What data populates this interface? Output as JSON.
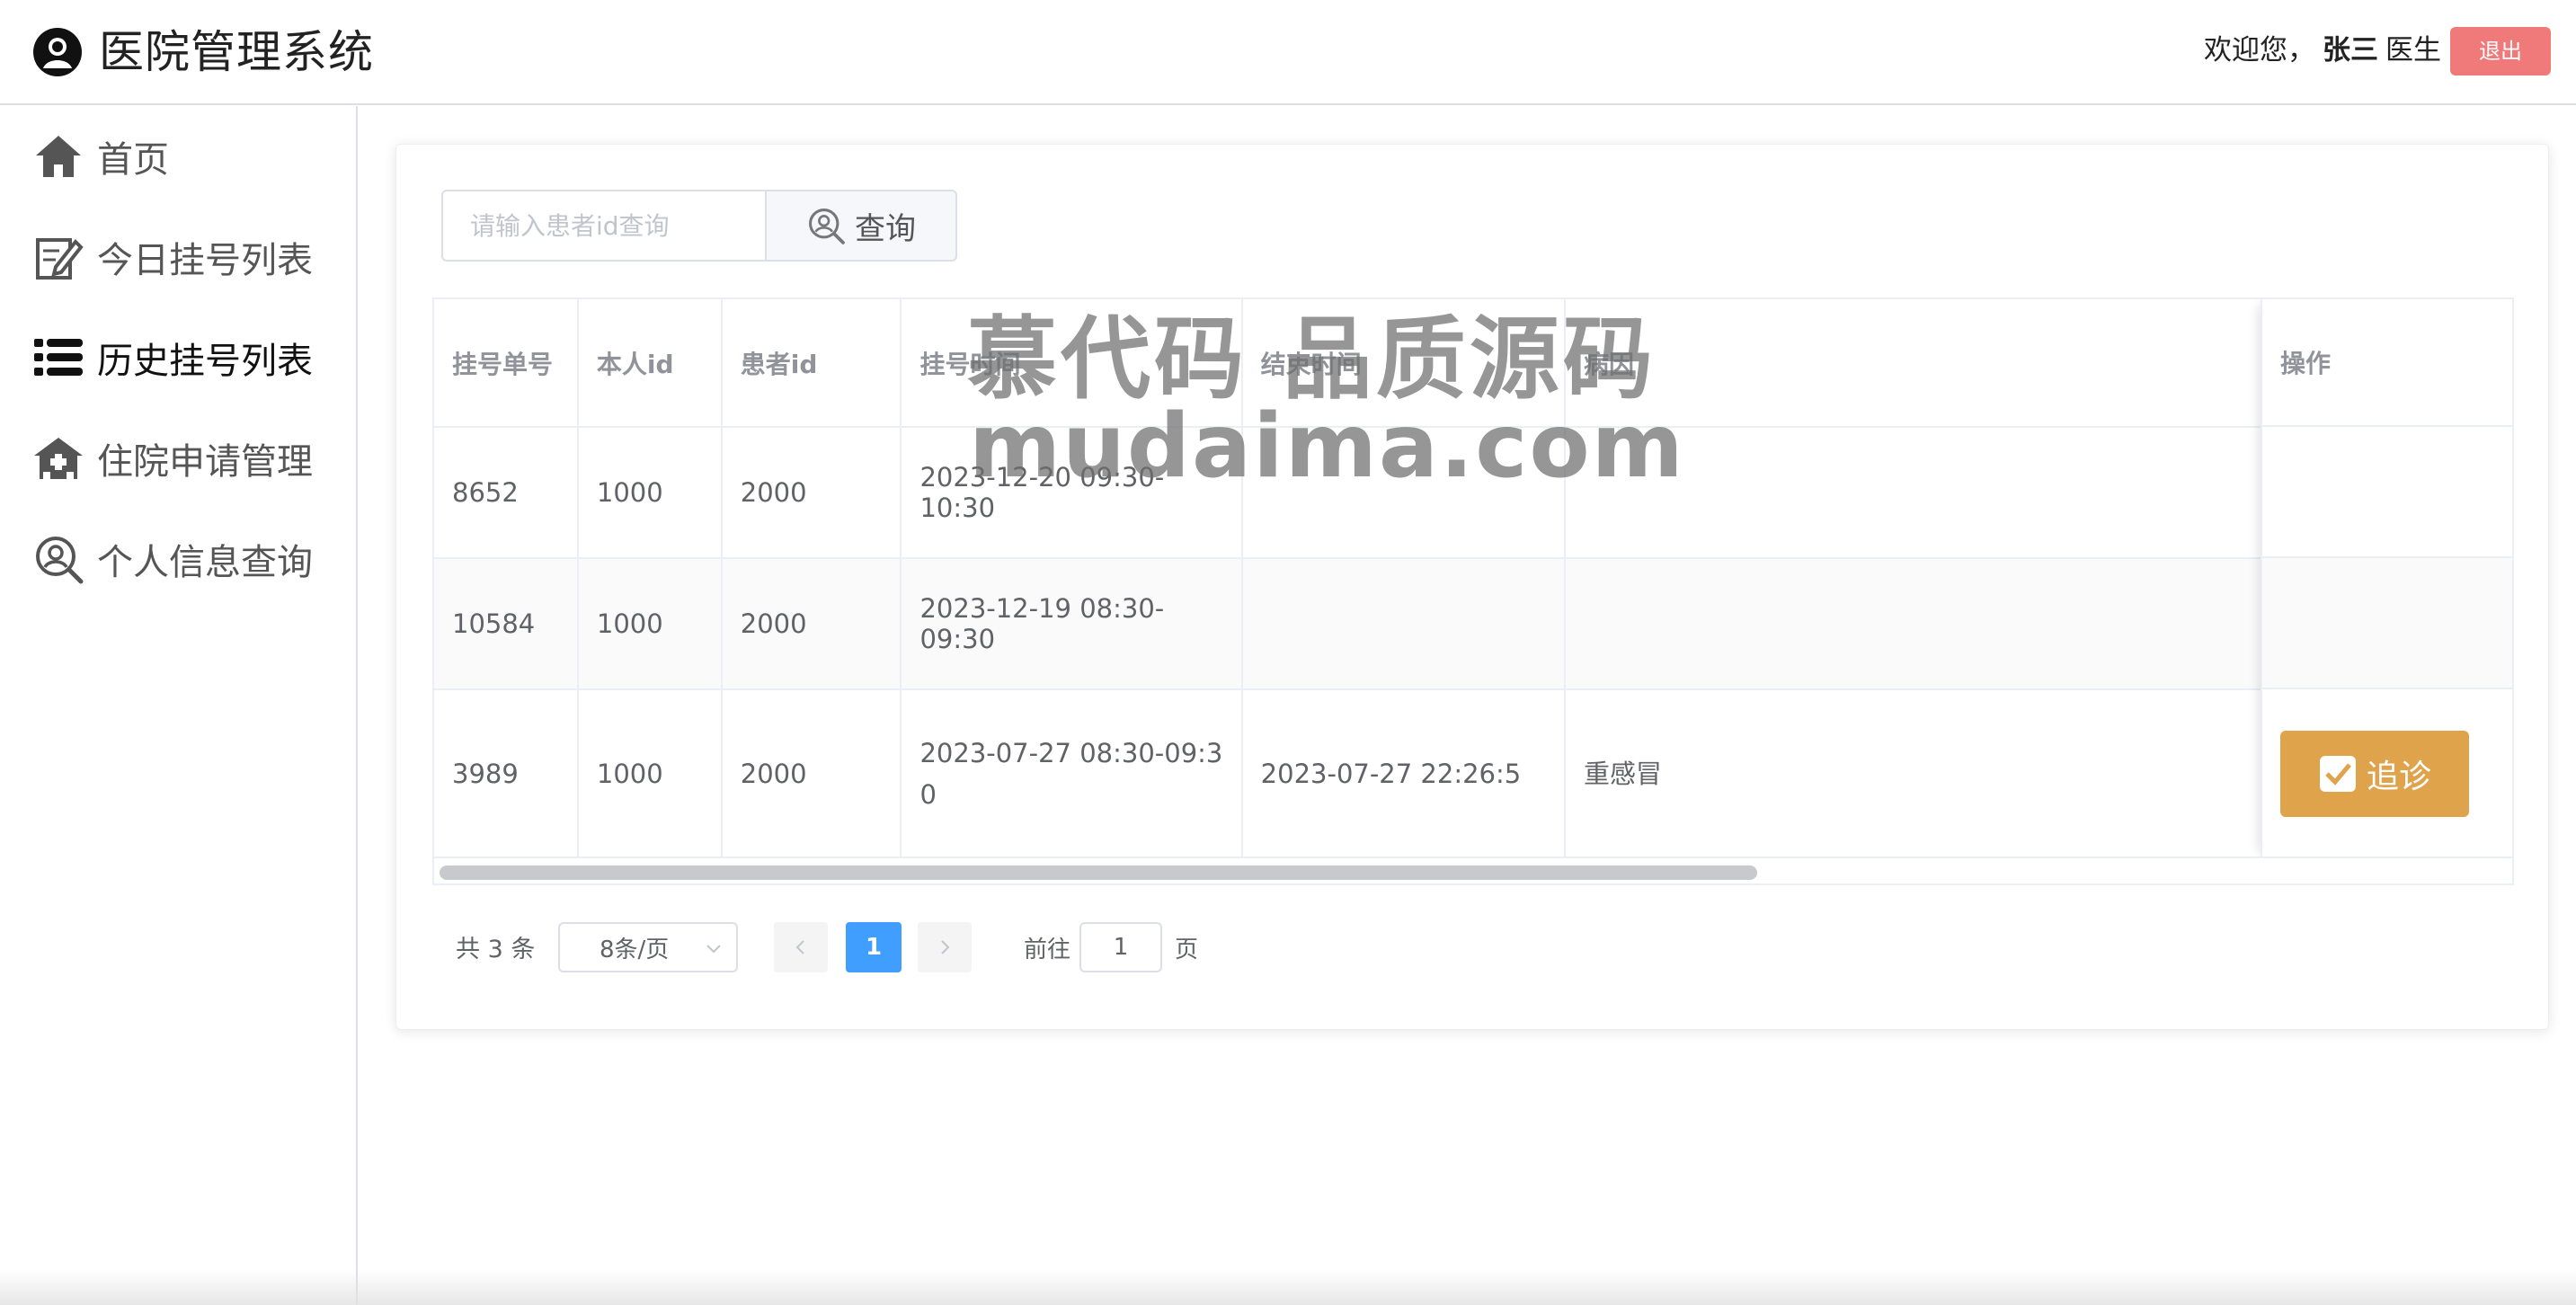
{
  "header": {
    "title": "医院管理系统",
    "welcome_prefix": "欢迎您，",
    "user_name": "张三",
    "role": "医生",
    "logout_label": "退出"
  },
  "sidebar": {
    "items": [
      {
        "label": "首页",
        "icon": "home-icon"
      },
      {
        "label": "今日挂号列表",
        "icon": "edit-note-icon"
      },
      {
        "label": "历史挂号列表",
        "icon": "list-icon",
        "active": true
      },
      {
        "label": "住院申请管理",
        "icon": "hospital-icon"
      },
      {
        "label": "个人信息查询",
        "icon": "search-user-icon"
      }
    ]
  },
  "search": {
    "placeholder": "请输入患者id查询",
    "value": "",
    "button_label": "查询"
  },
  "table": {
    "columns": [
      "挂号单号",
      "本人id",
      "患者id",
      "挂号时间",
      "结束时间",
      "病因",
      "操作"
    ],
    "rows": [
      {
        "id": "8652",
        "self_id": "1000",
        "patient_id": "2000",
        "reg_time": "2023-12-20 09:30-10:30",
        "end_time": "",
        "cause": ""
      },
      {
        "id": "10584",
        "self_id": "1000",
        "patient_id": "2000",
        "reg_time": "2023-12-19 08:30-09:30",
        "end_time": "",
        "cause": ""
      },
      {
        "id": "3989",
        "self_id": "1000",
        "patient_id": "2000",
        "reg_time": "2023-07-27 08:30-09:30",
        "end_time": "2023-07-27 22:26:5",
        "cause": "重感冒",
        "action": "追诊"
      }
    ]
  },
  "pagination": {
    "total_text": "共 3 条",
    "page_size": "8条/页",
    "current_page": "1",
    "goto_label": "前往",
    "goto_value": "1",
    "page_suffix": "页"
  },
  "watermark": {
    "line1": "慕代码 品质源码",
    "line2": "mudaima.com"
  },
  "colors": {
    "logout": "#f07a7a",
    "followup": "#dfa34c",
    "page_active": "#409eff"
  }
}
